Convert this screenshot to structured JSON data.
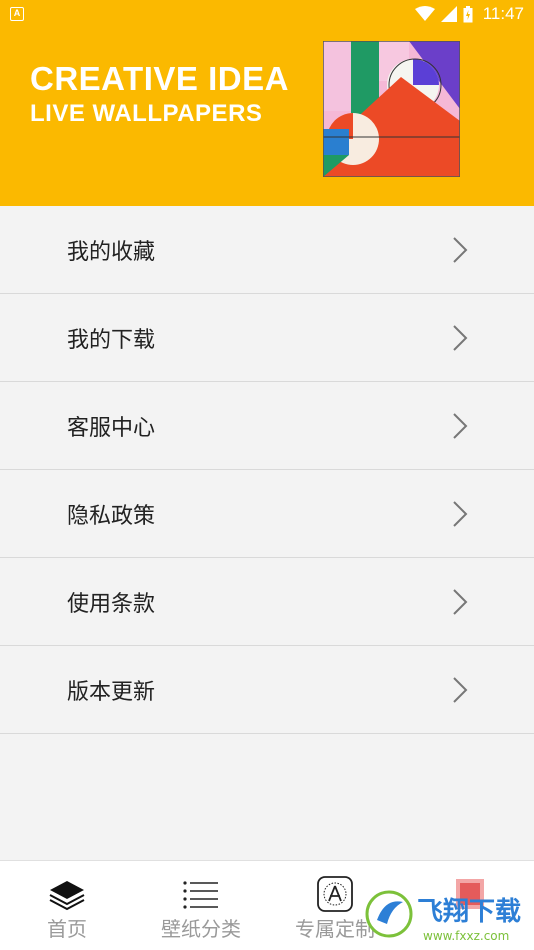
{
  "status_bar": {
    "time": "11:47",
    "notif_icon": "A"
  },
  "header": {
    "title_line1": "CREATIVE IDEA",
    "title_line2": "LIVE WALLPAPERS",
    "background_color": "#fbb900"
  },
  "menu": {
    "items": [
      {
        "label": "我的收藏"
      },
      {
        "label": "我的下载"
      },
      {
        "label": "客服中心"
      },
      {
        "label": "隐私政策"
      },
      {
        "label": "使用条款"
      },
      {
        "label": "版本更新"
      }
    ]
  },
  "bottom_nav": {
    "items": [
      {
        "label": "首页",
        "icon": "layers-icon"
      },
      {
        "label": "壁纸分类",
        "icon": "list-icon"
      },
      {
        "label": "专属定制",
        "icon": "app-store-icon"
      },
      {
        "label": "",
        "icon": "profile-icon"
      }
    ]
  },
  "watermark": {
    "text": "飞翔下载",
    "subtext": "www.fxxz.com"
  }
}
